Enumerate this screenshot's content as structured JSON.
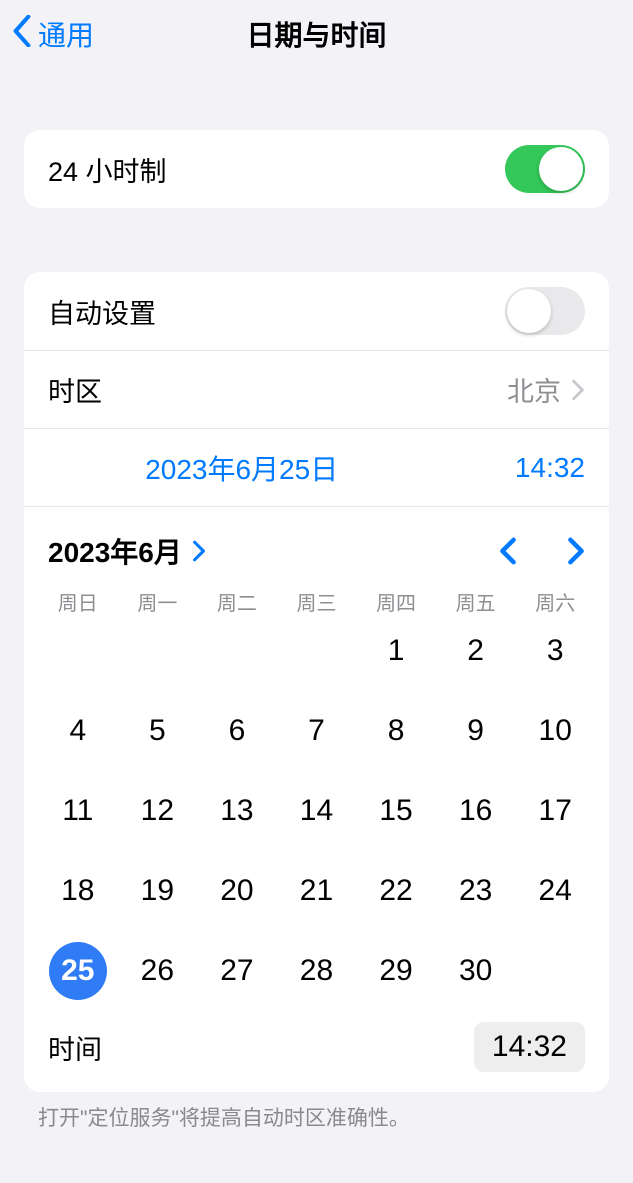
{
  "header": {
    "back_label": "通用",
    "title": "日期与时间"
  },
  "twenty_four_hour": {
    "label": "24 小时制",
    "value": true
  },
  "auto_set": {
    "label": "自动设置",
    "value": false
  },
  "timezone": {
    "label": "时区",
    "value": "北京"
  },
  "current": {
    "date_display": "2023年6月25日",
    "time_display": "14:32"
  },
  "calendar": {
    "month_label": "2023年6月",
    "weekdays": [
      "周日",
      "周一",
      "周二",
      "周三",
      "周四",
      "周五",
      "周六"
    ],
    "first_weekday_index": 4,
    "days_in_month": 30,
    "selected_day": 25
  },
  "time_row": {
    "label": "时间",
    "value": "14:32"
  },
  "footnote": "打开\"定位服务\"将提高自动时区准确性。"
}
